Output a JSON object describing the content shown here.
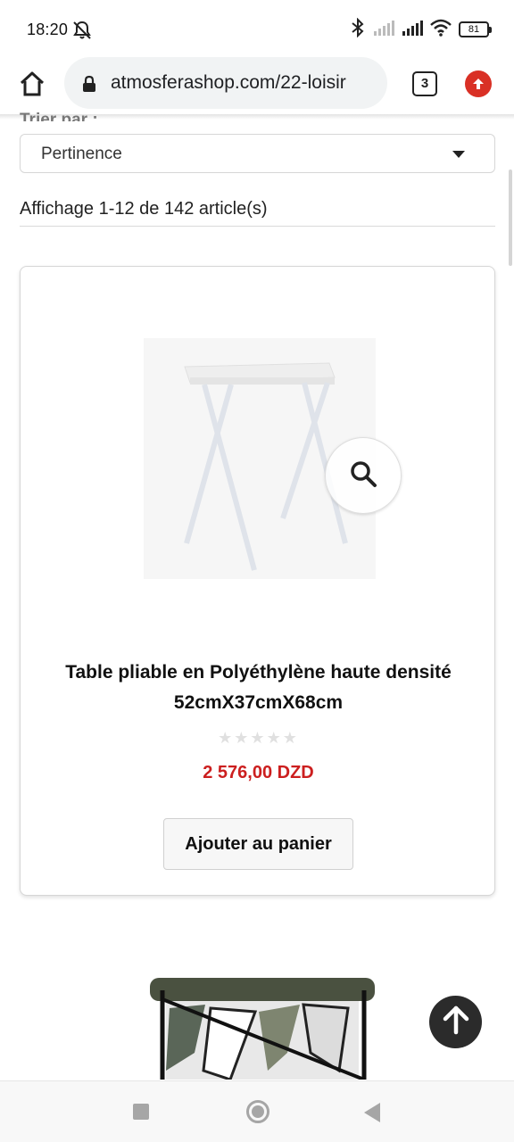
{
  "status_bar": {
    "time": "18:20",
    "battery": "81",
    "icons": [
      "alarm-off-icon",
      "bluetooth-icon",
      "signal-icon",
      "signal-icon",
      "wifi-icon",
      "battery-icon"
    ]
  },
  "browser": {
    "url": "atmosferashop.com/22-loisir",
    "tab_count": "3",
    "icons": [
      "home-icon",
      "lock-icon",
      "update-icon"
    ],
    "accent_color": "#d93025"
  },
  "listing": {
    "sort_label_clipped": "Trier par :",
    "sort_value": "Pertinence",
    "result_count": "Affichage 1-12 de 142 article(s)"
  },
  "products": [
    {
      "title": "Table pliable en Polyéthylène haute densité 52cmX37cmX68cm",
      "rating": "★★★★★",
      "price": "2 576,00 DZD",
      "add_to_cart": "Ajouter au panier"
    }
  ],
  "colors": {
    "price": "#cc1f1f",
    "back_to_top": "#2b2b2b"
  }
}
